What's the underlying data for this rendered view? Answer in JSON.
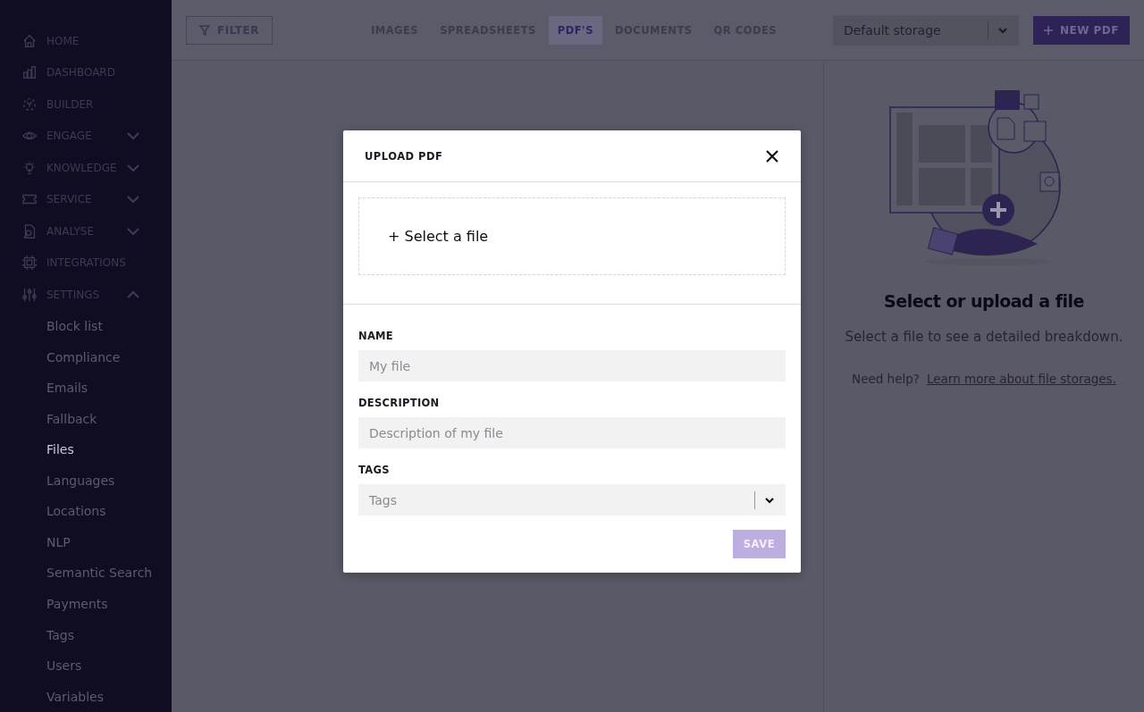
{
  "sidebar": {
    "items": [
      {
        "label": "HOME",
        "kind": "link"
      },
      {
        "label": "DASHBOARD",
        "kind": "link"
      },
      {
        "label": "BUILDER",
        "kind": "link"
      },
      {
        "label": "ENGAGE",
        "kind": "group",
        "expanded": false
      },
      {
        "label": "KNOWLEDGE",
        "kind": "group",
        "expanded": false
      },
      {
        "label": "SERVICE",
        "kind": "group",
        "expanded": false
      },
      {
        "label": "ANALYSE",
        "kind": "group",
        "expanded": false
      },
      {
        "label": "INTEGRATIONS",
        "kind": "link"
      },
      {
        "label": "SETTINGS",
        "kind": "group",
        "expanded": true,
        "children": [
          {
            "label": "Block list",
            "selected": false
          },
          {
            "label": "Compliance",
            "selected": false
          },
          {
            "label": "Emails",
            "selected": false
          },
          {
            "label": "Fallback",
            "selected": false
          },
          {
            "label": "Files",
            "selected": true
          },
          {
            "label": "Languages",
            "selected": false
          },
          {
            "label": "Locations",
            "selected": false
          },
          {
            "label": "NLP",
            "selected": false
          },
          {
            "label": "Semantic Search",
            "selected": false
          },
          {
            "label": "Payments",
            "selected": false
          },
          {
            "label": "Tags",
            "selected": false
          },
          {
            "label": "Users",
            "selected": false
          },
          {
            "label": "Variables",
            "selected": false
          }
        ]
      }
    ]
  },
  "toolbar": {
    "filter_button": "FILTER",
    "tabs": [
      {
        "label": "IMAGES",
        "selected": false
      },
      {
        "label": "SPREADSHEETS",
        "selected": false
      },
      {
        "label": "PDF'S",
        "selected": true
      },
      {
        "label": "DOCUMENTS",
        "selected": false
      },
      {
        "label": "QR CODES",
        "selected": false
      }
    ],
    "storage_select": {
      "value": "Default storage"
    },
    "new_button": "NEW PDF"
  },
  "detail_panel": {
    "title": "Select or upload a file",
    "subtitle": "Select a file to see a detailed breakdown.",
    "help_text": "Need help?",
    "help_link": "Learn more about file storages."
  },
  "dialog": {
    "title": "UPLOAD PDF",
    "dropzone": "+ Select a file",
    "fields": [
      {
        "label": "NAME",
        "kind": "text",
        "placeholder": "My file"
      },
      {
        "label": "DESCRIPTION",
        "kind": "text",
        "placeholder": "Description of my file"
      },
      {
        "label": "TAGS",
        "kind": "select",
        "placeholder": "Tags"
      }
    ],
    "save_button": {
      "label": "SAVE",
      "disabled": true
    }
  }
}
